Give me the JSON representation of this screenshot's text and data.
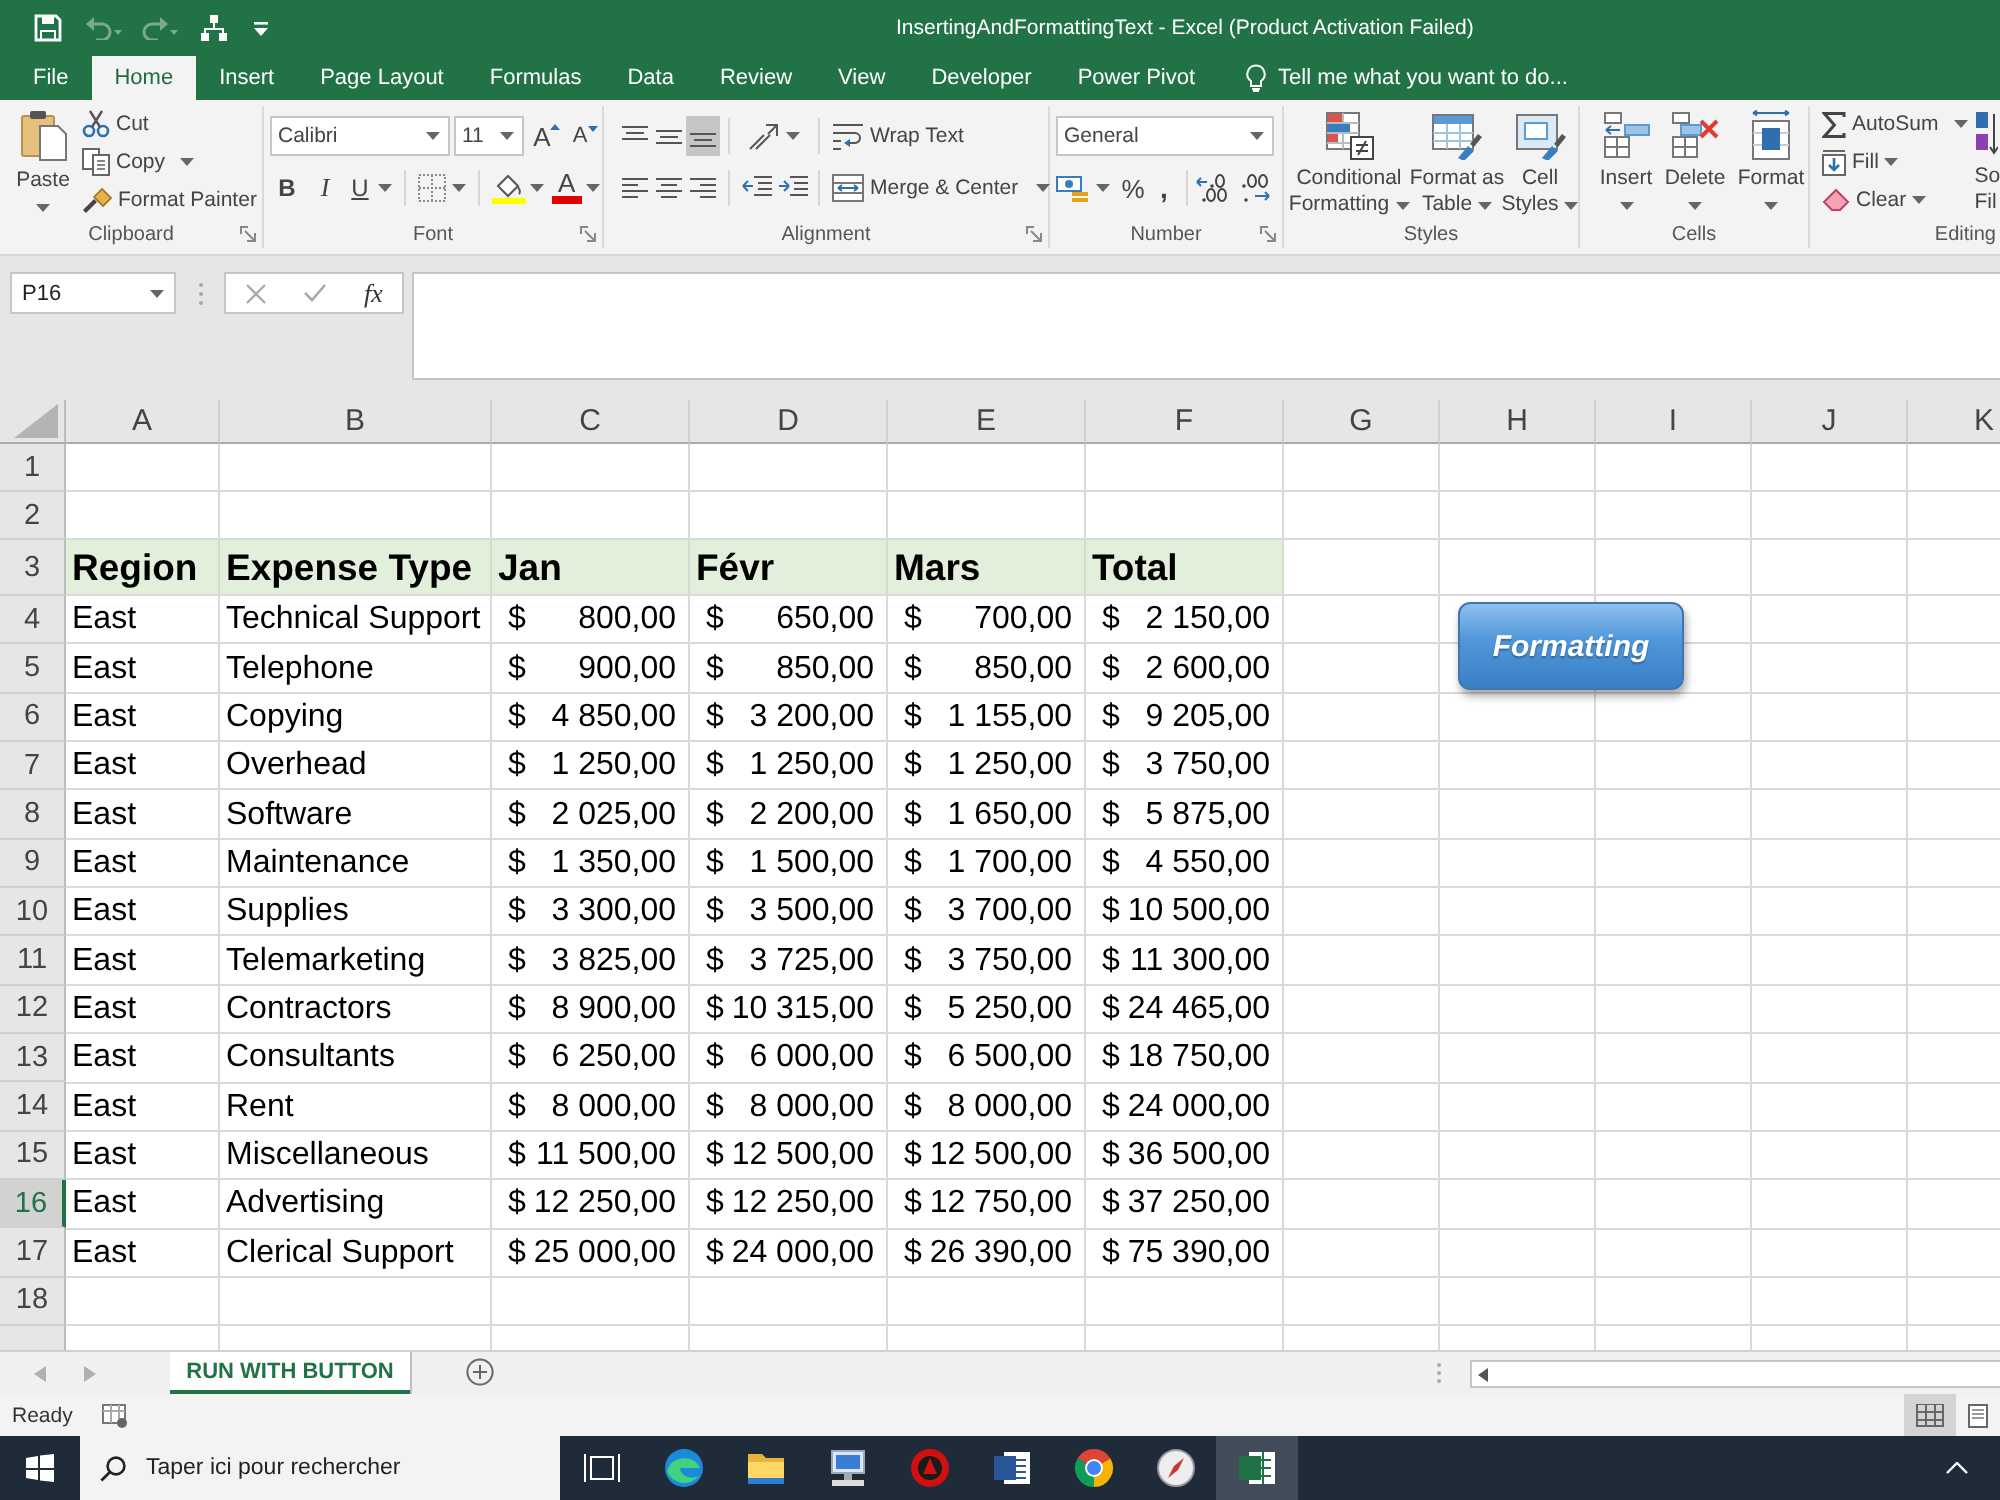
{
  "window": {
    "title": "InsertingAndFormattingText - Excel (Product Activation Failed)"
  },
  "quick_access": [
    {
      "kind": "save",
      "disabled": false
    },
    {
      "kind": "undo",
      "disabled": true
    },
    {
      "kind": "redo",
      "disabled": true
    },
    {
      "kind": "hierarchy",
      "disabled": false
    },
    {
      "kind": "customize",
      "disabled": false
    }
  ],
  "tabs": [
    {
      "label": "File",
      "selected": false
    },
    {
      "label": "Home",
      "selected": true
    },
    {
      "label": "Insert",
      "selected": false
    },
    {
      "label": "Page Layout",
      "selected": false
    },
    {
      "label": "Formulas",
      "selected": false
    },
    {
      "label": "Data",
      "selected": false
    },
    {
      "label": "Review",
      "selected": false
    },
    {
      "label": "View",
      "selected": false
    },
    {
      "label": "Developer",
      "selected": false
    },
    {
      "label": "Power Pivot",
      "selected": false
    }
  ],
  "tell_me": {
    "placeholder": "Tell me what you want to do..."
  },
  "ribbon": {
    "clipboard": {
      "label": "Clipboard",
      "paste": "Paste",
      "cut": "Cut",
      "copy": "Copy",
      "format_painter": "Format Painter"
    },
    "font": {
      "label": "Font",
      "font_name": "Calibri",
      "font_size": "11",
      "grow": "A",
      "shrink": "A",
      "bold": "B",
      "italic": "I",
      "underline": "U",
      "font_color": "A"
    },
    "alignment": {
      "label": "Alignment",
      "vertical": [
        {
          "kind": "top",
          "selected": false
        },
        {
          "kind": "middle",
          "selected": false
        },
        {
          "kind": "bottom",
          "selected": true
        }
      ],
      "horizontal": [
        {
          "kind": "left",
          "selected": false
        },
        {
          "kind": "center",
          "selected": false
        },
        {
          "kind": "right",
          "selected": false
        }
      ],
      "wrap_text": "Wrap Text",
      "merge_center": "Merge & Center"
    },
    "number": {
      "label": "Number",
      "format": "General",
      "percent": "%",
      "comma": ","
    },
    "styles": {
      "label": "Styles",
      "buttons": [
        {
          "kind": "conditional",
          "lines": [
            "Conditional",
            "Formatting"
          ]
        },
        {
          "kind": "table",
          "lines": [
            "Format as",
            "Table"
          ]
        },
        {
          "kind": "cell",
          "lines": [
            "Cell",
            "Styles"
          ]
        }
      ]
    },
    "cells": {
      "label": "Cells",
      "buttons": [
        {
          "kind": "insert",
          "label": "Insert"
        },
        {
          "kind": "delete",
          "label": "Delete"
        },
        {
          "kind": "format",
          "label": "Format"
        }
      ]
    },
    "editing": {
      "label": "Editing",
      "autosum": "AutoSum",
      "fill": "Fill",
      "clear": "Clear",
      "sort_filter": [
        "So",
        "Fil"
      ]
    }
  },
  "formula_bar": {
    "name_box": "P16",
    "function_label": "fx"
  },
  "sheet": {
    "columns": [
      "A",
      "B",
      "C",
      "D",
      "E",
      "F",
      "G",
      "H",
      "I",
      "J",
      "K"
    ],
    "rows": [
      {
        "number": "1",
        "kind": "empty",
        "highlighted": false
      },
      {
        "number": "2",
        "kind": "empty",
        "highlighted": false
      },
      {
        "number": "3",
        "kind": "header",
        "highlighted": false,
        "cells": [
          "Region",
          "Expense Type",
          "Jan",
          "Févr",
          "Mars",
          "Total"
        ]
      },
      {
        "number": "4",
        "kind": "data",
        "highlighted": false,
        "region": "East",
        "expense_type": "Technical Support",
        "amounts": [
          {
            "symbol": "$",
            "value": "800,00"
          },
          {
            "symbol": "$",
            "value": "650,00"
          },
          {
            "symbol": "$",
            "value": "700,00"
          },
          {
            "symbol": "$",
            "value": "2 150,00"
          }
        ]
      },
      {
        "number": "5",
        "kind": "data",
        "highlighted": false,
        "region": "East",
        "expense_type": "Telephone",
        "amounts": [
          {
            "symbol": "$",
            "value": "900,00"
          },
          {
            "symbol": "$",
            "value": "850,00"
          },
          {
            "symbol": "$",
            "value": "850,00"
          },
          {
            "symbol": "$",
            "value": "2 600,00"
          }
        ]
      },
      {
        "number": "6",
        "kind": "data",
        "highlighted": false,
        "region": "East",
        "expense_type": "Copying",
        "amounts": [
          {
            "symbol": "$",
            "value": "4 850,00"
          },
          {
            "symbol": "$",
            "value": "3 200,00"
          },
          {
            "symbol": "$",
            "value": "1 155,00"
          },
          {
            "symbol": "$",
            "value": "9 205,00"
          }
        ]
      },
      {
        "number": "7",
        "kind": "data",
        "highlighted": false,
        "region": "East",
        "expense_type": "Overhead",
        "amounts": [
          {
            "symbol": "$",
            "value": "1 250,00"
          },
          {
            "symbol": "$",
            "value": "1 250,00"
          },
          {
            "symbol": "$",
            "value": "1 250,00"
          },
          {
            "symbol": "$",
            "value": "3 750,00"
          }
        ]
      },
      {
        "number": "8",
        "kind": "data",
        "highlighted": false,
        "region": "East",
        "expense_type": "Software",
        "amounts": [
          {
            "symbol": "$",
            "value": "2 025,00"
          },
          {
            "symbol": "$",
            "value": "2 200,00"
          },
          {
            "symbol": "$",
            "value": "1 650,00"
          },
          {
            "symbol": "$",
            "value": "5 875,00"
          }
        ]
      },
      {
        "number": "9",
        "kind": "data",
        "highlighted": false,
        "region": "East",
        "expense_type": "Maintenance",
        "amounts": [
          {
            "symbol": "$",
            "value": "1 350,00"
          },
          {
            "symbol": "$",
            "value": "1 500,00"
          },
          {
            "symbol": "$",
            "value": "1 700,00"
          },
          {
            "symbol": "$",
            "value": "4 550,00"
          }
        ]
      },
      {
        "number": "10",
        "kind": "data",
        "highlighted": false,
        "region": "East",
        "expense_type": "Supplies",
        "amounts": [
          {
            "symbol": "$",
            "value": "3 300,00"
          },
          {
            "symbol": "$",
            "value": "3 500,00"
          },
          {
            "symbol": "$",
            "value": "3 700,00"
          },
          {
            "symbol": "$",
            "value": "10 500,00"
          }
        ]
      },
      {
        "number": "11",
        "kind": "data",
        "highlighted": false,
        "region": "East",
        "expense_type": "Telemarketing",
        "amounts": [
          {
            "symbol": "$",
            "value": "3 825,00"
          },
          {
            "symbol": "$",
            "value": "3 725,00"
          },
          {
            "symbol": "$",
            "value": "3 750,00"
          },
          {
            "symbol": "$",
            "value": "11 300,00"
          }
        ]
      },
      {
        "number": "12",
        "kind": "data",
        "highlighted": false,
        "region": "East",
        "expense_type": "Contractors",
        "amounts": [
          {
            "symbol": "$",
            "value": "8 900,00"
          },
          {
            "symbol": "$",
            "value": "10 315,00"
          },
          {
            "symbol": "$",
            "value": "5 250,00"
          },
          {
            "symbol": "$",
            "value": "24 465,00"
          }
        ]
      },
      {
        "number": "13",
        "kind": "data",
        "highlighted": false,
        "region": "East",
        "expense_type": "Consultants",
        "amounts": [
          {
            "symbol": "$",
            "value": "6 250,00"
          },
          {
            "symbol": "$",
            "value": "6 000,00"
          },
          {
            "symbol": "$",
            "value": "6 500,00"
          },
          {
            "symbol": "$",
            "value": "18 750,00"
          }
        ]
      },
      {
        "number": "14",
        "kind": "data",
        "highlighted": false,
        "region": "East",
        "expense_type": "Rent",
        "amounts": [
          {
            "symbol": "$",
            "value": "8 000,00"
          },
          {
            "symbol": "$",
            "value": "8 000,00"
          },
          {
            "symbol": "$",
            "value": "8 000,00"
          },
          {
            "symbol": "$",
            "value": "24 000,00"
          }
        ]
      },
      {
        "number": "15",
        "kind": "data",
        "highlighted": false,
        "region": "East",
        "expense_type": "Miscellaneous",
        "amounts": [
          {
            "symbol": "$",
            "value": "11 500,00"
          },
          {
            "symbol": "$",
            "value": "12 500,00"
          },
          {
            "symbol": "$",
            "value": "12 500,00"
          },
          {
            "symbol": "$",
            "value": "36 500,00"
          }
        ]
      },
      {
        "number": "16",
        "kind": "data",
        "highlighted": true,
        "region": "East",
        "expense_type": "Advertising",
        "amounts": [
          {
            "symbol": "$",
            "value": "12 250,00"
          },
          {
            "symbol": "$",
            "value": "12 250,00"
          },
          {
            "symbol": "$",
            "value": "12 750,00"
          },
          {
            "symbol": "$",
            "value": "37 250,00"
          }
        ]
      },
      {
        "number": "17",
        "kind": "data",
        "highlighted": false,
        "region": "East",
        "expense_type": "Clerical Support",
        "amounts": [
          {
            "symbol": "$",
            "value": "25 000,00"
          },
          {
            "symbol": "$",
            "value": "24 000,00"
          },
          {
            "symbol": "$",
            "value": "26 390,00"
          },
          {
            "symbol": "$",
            "value": "75 390,00"
          }
        ]
      },
      {
        "number": "18",
        "kind": "empty",
        "highlighted": false
      }
    ],
    "button": {
      "label": "Formatting"
    }
  },
  "sheet_tabs": [
    {
      "label": "RUN WITH BUTTON",
      "selected": true
    }
  ],
  "status_bar": {
    "text": "Ready",
    "views": [
      {
        "kind": "normal",
        "selected": true
      },
      {
        "kind": "page-layout",
        "selected": false
      }
    ]
  },
  "taskbar": {
    "search_placeholder": "Taper ici pour rechercher",
    "apps": [
      {
        "kind": "taskview",
        "selected": false
      },
      {
        "kind": "browser",
        "selected": false
      },
      {
        "kind": "folder",
        "selected": false
      },
      {
        "kind": "computer",
        "selected": false
      },
      {
        "kind": "emblem",
        "selected": false
      },
      {
        "kind": "document",
        "selected": false
      },
      {
        "kind": "ring",
        "selected": false
      },
      {
        "kind": "compass",
        "selected": false
      },
      {
        "kind": "spreadsheet",
        "selected": true
      }
    ]
  }
}
